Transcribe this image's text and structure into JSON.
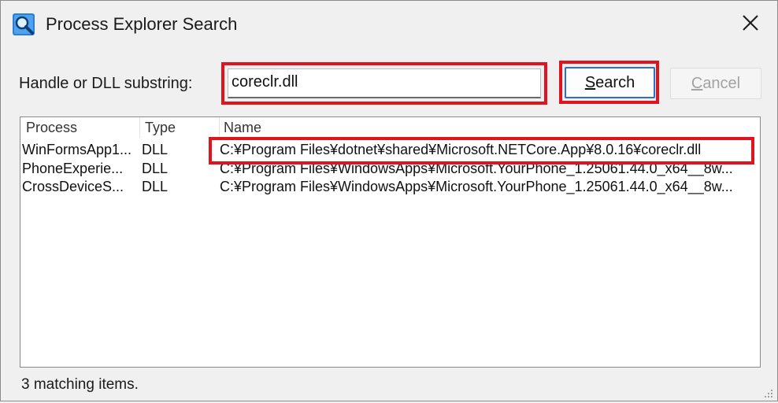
{
  "window": {
    "title": "Process Explorer Search",
    "icon": "magnifier-app-icon",
    "close_icon": "close-icon"
  },
  "search": {
    "label": "Handle or DLL substring:",
    "value": "coreclr.dll",
    "search_button_prefix": "",
    "search_button_accel": "S",
    "search_button_rest": "earch",
    "cancel_button_accel": "C",
    "cancel_button_rest": "ancel"
  },
  "results": {
    "columns": [
      "Process",
      "Type",
      "Name"
    ],
    "rows": [
      {
        "process": "WinFormsApp1...",
        "type": "DLL",
        "name": "C:¥Program Files¥dotnet¥shared¥Microsoft.NETCore.App¥8.0.16¥coreclr.dll"
      },
      {
        "process": "PhoneExperie...",
        "type": "DLL",
        "name": "C:¥Program Files¥WindowsApps¥Microsoft.YourPhone_1.25061.44.0_x64__8w..."
      },
      {
        "process": "CrossDeviceS...",
        "type": "DLL",
        "name": "C:¥Program Files¥WindowsApps¥Microsoft.YourPhone_1.25061.44.0_x64__8w..."
      }
    ]
  },
  "status": {
    "text": "3 matching items."
  },
  "colors": {
    "highlight": "#e0141e",
    "accent": "#2f6fc6"
  }
}
